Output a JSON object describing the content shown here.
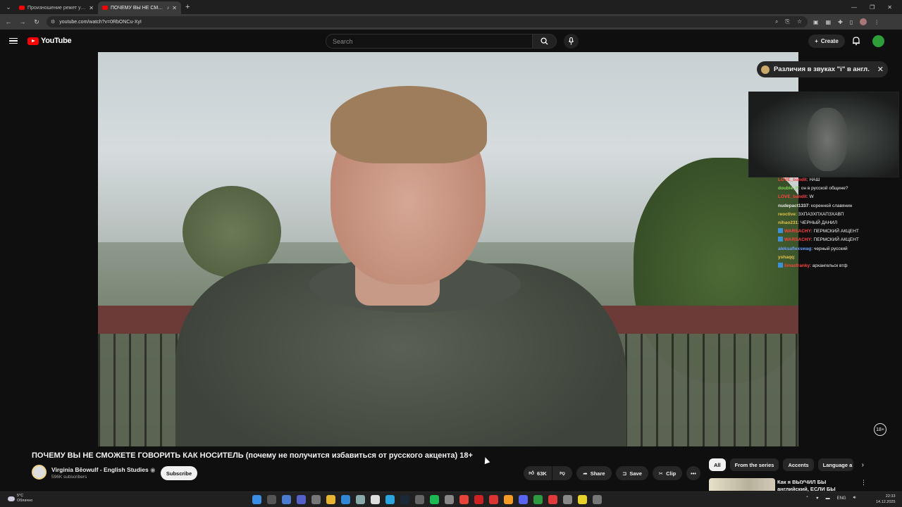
{
  "browser": {
    "tabs": [
      {
        "title": "Произношение режет уход что?",
        "active": false
      },
      {
        "title": "ПОЧЕМУ ВЫ НЕ СМОЖЕТЕ ГОВОРИТЬ КАК НОСИТЕЛЬ",
        "active": true
      }
    ],
    "url": "youtube.com/watch?v=0RbONCu-XyI"
  },
  "youtube": {
    "logo_text": "YouTube",
    "search_placeholder": "Search",
    "create_label": "Create"
  },
  "overlay": {
    "notification": "Различия в звуках \"i\" в англ.",
    "chat": [
      {
        "user": "LOVE_bandit",
        "msg": "НАШ",
        "color": "#ff4141"
      },
      {
        "user": "double_ff",
        "msg": "он в русской общине?",
        "color": "#7fd35a"
      },
      {
        "user": "LOVE_bandit",
        "msg": "W",
        "color": "#ff4141"
      },
      {
        "user": "nudepact1337",
        "msg": "коренной славянин",
        "color": "#e7e7e7"
      },
      {
        "user": "reoctive",
        "msg": "ЗХПАЗХПХАПЗХАВП",
        "color": "#e3c24a"
      },
      {
        "user": "nihao231",
        "msg": "ЧЕРНЫЙ ДАНИЛ",
        "color": "#e3c24a"
      },
      {
        "user": "WARSACHY",
        "msg": "ПЕРМСКИЙ АКЦЕНТ",
        "color": "#ff4141",
        "badge": true
      },
      {
        "user": "WARSACHY",
        "msg": "ПЕРМСКИЙ АКЦЕНТ",
        "color": "#ff4141",
        "badge": true
      },
      {
        "user": "aleksaflexswag",
        "msg": "черный русский",
        "color": "#6aa0ff"
      },
      {
        "user": "yshaqq",
        "msg": "",
        "color": "#e3c24a"
      },
      {
        "user": "limasfranky",
        "msg": "архангельск втф",
        "color": "#ff4141",
        "badge": true
      }
    ]
  },
  "video": {
    "title": "ПОЧЕМУ ВЫ НЕ СМОЖЕТЕ ГОВОРИТЬ КАК НОСИТЕЛЬ (почему не получится избавиться от русского акцента) 18+",
    "age_badge": "18+",
    "channel": "Virginia Bēowulf - English Studies",
    "subscribers": "596K subscribers",
    "subscribe_label": "Subscribe",
    "likes": "63K",
    "share_label": "Share",
    "save_label": "Save",
    "clip_label": "Clip"
  },
  "sidebar": {
    "chips": [
      "All",
      "From the series",
      "Accents",
      "Language a"
    ],
    "rec_title": "Как я ВЫУЧИЛ БЫ английский, ЕСЛИ БЫ ЗАБЫЛ"
  },
  "taskbar": {
    "temp": "5°C",
    "weather": "Облачно",
    "lang": "ENG",
    "time": "22:33",
    "date": "14.12.2025"
  }
}
